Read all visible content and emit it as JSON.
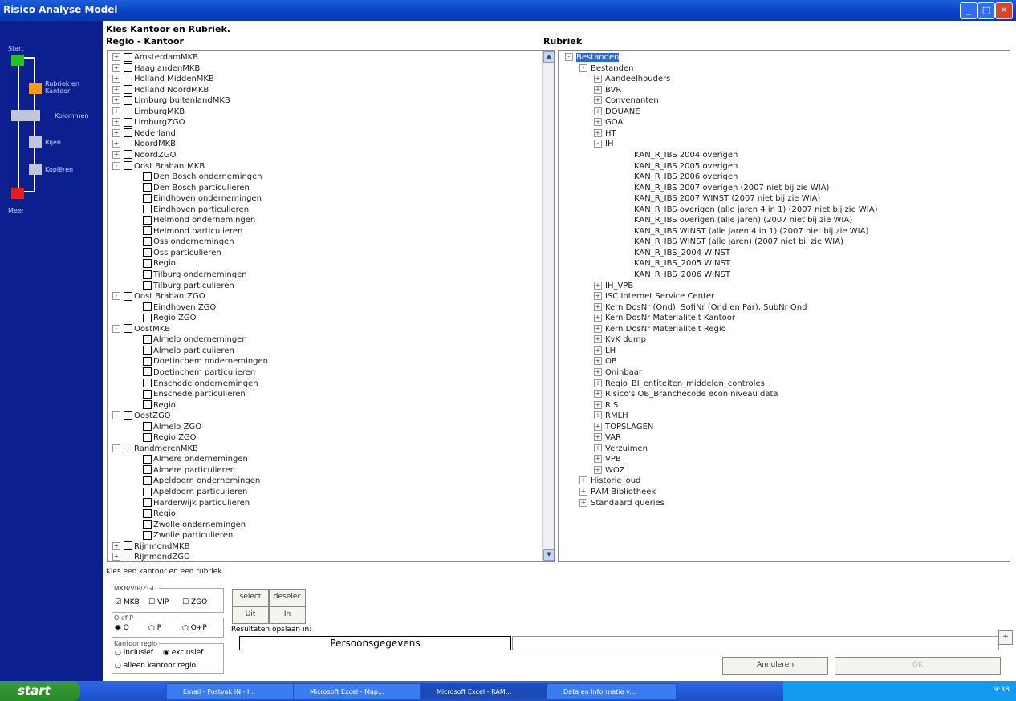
{
  "window": {
    "title": "Risico Analyse Model"
  },
  "wizard": {
    "steps": [
      "Start",
      "Rubriek en Kantoor",
      "Kolommen",
      "Rijen",
      "Kopiëren",
      "Meer"
    ]
  },
  "main": {
    "heading": "Kies Kantoor en Rubriek.",
    "left_header": "Regio - Kantoor",
    "right_header": "Rubriek"
  },
  "left_tree": [
    {
      "l": 0,
      "e": "+",
      "c": true,
      "t": "AmsterdamMKB"
    },
    {
      "l": 0,
      "e": "+",
      "c": true,
      "t": "HaaglandenMKB"
    },
    {
      "l": 0,
      "e": "+",
      "c": true,
      "t": "Holland MiddenMKB"
    },
    {
      "l": 0,
      "e": "+",
      "c": true,
      "t": "Holland NoordMKB"
    },
    {
      "l": 0,
      "e": "+",
      "c": true,
      "t": "Limburg buitenlandMKB"
    },
    {
      "l": 0,
      "e": "+",
      "c": true,
      "t": "LimburgMKB"
    },
    {
      "l": 0,
      "e": "+",
      "c": true,
      "t": "LimburgZGO"
    },
    {
      "l": 0,
      "e": "+",
      "c": true,
      "t": "Nederland"
    },
    {
      "l": 0,
      "e": "+",
      "c": true,
      "t": "NoordMKB"
    },
    {
      "l": 0,
      "e": "+",
      "c": true,
      "t": "NoordZGO"
    },
    {
      "l": 0,
      "e": "-",
      "c": true,
      "t": "Oost BrabantMKB"
    },
    {
      "l": 1,
      "e": "",
      "c": true,
      "t": "Den Bosch ondernemingen"
    },
    {
      "l": 1,
      "e": "",
      "c": true,
      "t": "Den Bosch particulieren"
    },
    {
      "l": 1,
      "e": "",
      "c": true,
      "t": "Eindhoven ondernemingen"
    },
    {
      "l": 1,
      "e": "",
      "c": true,
      "t": "Eindhoven particulieren"
    },
    {
      "l": 1,
      "e": "",
      "c": true,
      "t": "Helmond ondernemingen"
    },
    {
      "l": 1,
      "e": "",
      "c": true,
      "t": "Helmond particulieren"
    },
    {
      "l": 1,
      "e": "",
      "c": true,
      "t": "Oss ondernemingen"
    },
    {
      "l": 1,
      "e": "",
      "c": true,
      "t": "Oss particulieren"
    },
    {
      "l": 1,
      "e": "",
      "c": true,
      "t": "Regio"
    },
    {
      "l": 1,
      "e": "",
      "c": true,
      "t": "Tilburg ondernemingen"
    },
    {
      "l": 1,
      "e": "",
      "c": true,
      "t": "Tilburg particulieren"
    },
    {
      "l": 0,
      "e": "-",
      "c": true,
      "t": "Oost BrabantZGO"
    },
    {
      "l": 1,
      "e": "",
      "c": true,
      "t": "Eindhoven ZGO"
    },
    {
      "l": 1,
      "e": "",
      "c": true,
      "t": "Regio ZGO"
    },
    {
      "l": 0,
      "e": "-",
      "c": true,
      "t": "OostMKB"
    },
    {
      "l": 1,
      "e": "",
      "c": true,
      "t": "Almelo ondernemingen"
    },
    {
      "l": 1,
      "e": "",
      "c": true,
      "t": "Almelo particulieren"
    },
    {
      "l": 1,
      "e": "",
      "c": true,
      "t": "Doetinchem ondernemingen"
    },
    {
      "l": 1,
      "e": "",
      "c": true,
      "t": "Doetinchem particulieren"
    },
    {
      "l": 1,
      "e": "",
      "c": true,
      "t": "Enschede ondernemingen"
    },
    {
      "l": 1,
      "e": "",
      "c": true,
      "t": "Enschede particulieren"
    },
    {
      "l": 1,
      "e": "",
      "c": true,
      "t": "Regio"
    },
    {
      "l": 0,
      "e": "-",
      "c": true,
      "t": "OostZGO"
    },
    {
      "l": 1,
      "e": "",
      "c": true,
      "t": "Almelo ZGO"
    },
    {
      "l": 1,
      "e": "",
      "c": true,
      "t": "Regio ZGO"
    },
    {
      "l": 0,
      "e": "-",
      "c": true,
      "t": "RandmerenMKB"
    },
    {
      "l": 1,
      "e": "",
      "c": true,
      "t": "Almere ondernemingen"
    },
    {
      "l": 1,
      "e": "",
      "c": true,
      "t": "Almere particulieren"
    },
    {
      "l": 1,
      "e": "",
      "c": true,
      "t": "Apeldoorn ondernemingen"
    },
    {
      "l": 1,
      "e": "",
      "c": true,
      "t": "Apeldoorn particulieren"
    },
    {
      "l": 1,
      "e": "",
      "c": true,
      "t": "Harderwijk particulieren"
    },
    {
      "l": 1,
      "e": "",
      "c": true,
      "t": "Regio"
    },
    {
      "l": 1,
      "e": "",
      "c": true,
      "t": "Zwolle ondernemingen"
    },
    {
      "l": 1,
      "e": "",
      "c": true,
      "t": "Zwolle particulieren"
    },
    {
      "l": 0,
      "e": "+",
      "c": true,
      "t": "RijnmondMKB"
    },
    {
      "l": 0,
      "e": "+",
      "c": true,
      "t": "RijnmondZGO"
    }
  ],
  "right_tree": [
    {
      "l": 0,
      "e": "-",
      "t": "Bestanden",
      "sel": true
    },
    {
      "l": 1,
      "e": "-",
      "t": "Bestanden"
    },
    {
      "l": 2,
      "e": "+",
      "t": "Aandeelhouders"
    },
    {
      "l": 2,
      "e": "+",
      "t": "BVR"
    },
    {
      "l": 2,
      "e": "+",
      "t": "Convenanten"
    },
    {
      "l": 2,
      "e": "+",
      "t": "DOUANE"
    },
    {
      "l": 2,
      "e": "+",
      "t": "GOA"
    },
    {
      "l": 2,
      "e": "+",
      "t": "HT"
    },
    {
      "l": 2,
      "e": "-",
      "t": "IH"
    },
    {
      "l": 4,
      "e": "",
      "t": "KAN_R_IBS 2004 overigen"
    },
    {
      "l": 4,
      "e": "",
      "t": "KAN_R_IBS 2005 overigen"
    },
    {
      "l": 4,
      "e": "",
      "t": "KAN_R_IBS 2006 overigen"
    },
    {
      "l": 4,
      "e": "",
      "t": "KAN_R_IBS 2007 overigen (2007 niet bij zie WIA)"
    },
    {
      "l": 4,
      "e": "",
      "t": "KAN_R_IBS 2007 WINST (2007 niet bij zie WIA)"
    },
    {
      "l": 4,
      "e": "",
      "t": "KAN_R_IBS overigen (alle jaren 4 in 1) (2007 niet bij zie WIA)"
    },
    {
      "l": 4,
      "e": "",
      "t": "KAN_R_IBS overigen (alle jaren) (2007 niet bij zie WIA)"
    },
    {
      "l": 4,
      "e": "",
      "t": "KAN_R_IBS WINST  (alle jaren 4 in 1) (2007 niet bij zie WIA)"
    },
    {
      "l": 4,
      "e": "",
      "t": "KAN_R_IBS WINST  (alle jaren) (2007 niet bij zie WIA)"
    },
    {
      "l": 4,
      "e": "",
      "t": "KAN_R_IBS_2004 WINST"
    },
    {
      "l": 4,
      "e": "",
      "t": "KAN_R_IBS_2005 WINST"
    },
    {
      "l": 4,
      "e": "",
      "t": "KAN_R_IBS_2006 WINST"
    },
    {
      "l": 2,
      "e": "+",
      "t": "IH_VPB"
    },
    {
      "l": 2,
      "e": "+",
      "t": "ISC Internet Service Center"
    },
    {
      "l": 2,
      "e": "+",
      "t": "Kern DosNr (Ond), SofiNr (Ond en Par), SubNr Ond"
    },
    {
      "l": 2,
      "e": "+",
      "t": "Kern DosNr Materialiteit Kantoor"
    },
    {
      "l": 2,
      "e": "+",
      "t": "Kern DosNr Materialiteit Regio"
    },
    {
      "l": 2,
      "e": "+",
      "t": "KvK dump"
    },
    {
      "l": 2,
      "e": "+",
      "t": "LH"
    },
    {
      "l": 2,
      "e": "+",
      "t": "OB"
    },
    {
      "l": 2,
      "e": "+",
      "t": "Oninbaar"
    },
    {
      "l": 2,
      "e": "+",
      "t": "Regio_BI_entiteiten_middelen_controles"
    },
    {
      "l": 2,
      "e": "+",
      "t": "Risico's OB_Branchecode econ niveau data"
    },
    {
      "l": 2,
      "e": "+",
      "t": "RIS"
    },
    {
      "l": 2,
      "e": "+",
      "t": "RMLH"
    },
    {
      "l": 2,
      "e": "+",
      "t": "TOPSLAGEN"
    },
    {
      "l": 2,
      "e": "+",
      "t": "VAR"
    },
    {
      "l": 2,
      "e": "+",
      "t": "Verzuimen"
    },
    {
      "l": 2,
      "e": "+",
      "t": "VPB"
    },
    {
      "l": 2,
      "e": "+",
      "t": "WOZ"
    },
    {
      "l": 1,
      "e": "+",
      "t": "Historie_oud"
    },
    {
      "l": 1,
      "e": "+",
      "t": "RAM Bibliotheek"
    },
    {
      "l": 1,
      "e": "+",
      "t": "Standaard queries"
    }
  ],
  "status": "Kies een kantoor en een rubriek",
  "filters": {
    "group1_legend": "MKB/VIP/ZGO",
    "mkb": "MKB",
    "vip": "VIP",
    "zgo": "ZGO",
    "group2_legend": "O of P",
    "o": "O",
    "p": "P",
    "op": "O+P",
    "group3_legend": "Kantoor regio",
    "inclusief": "inclusief",
    "exclusief": "exclusief",
    "alleen": "alleen kantoor regio"
  },
  "buttons": {
    "select": "select",
    "deselect": "deselec",
    "uit": "Uit",
    "in": "In",
    "plus": "+",
    "annuleren": "Annuleren",
    "ok": "OK"
  },
  "save": {
    "label": "Resultaten opslaan in:",
    "value": "Persoonsgegevens"
  },
  "taskbar": {
    "start": "start",
    "items": [
      "Email - Postvak IN - I...",
      "Microsoft Excel - Map...",
      "Microsoft Excel - RAM...",
      "Data en Informatie v..."
    ],
    "clock": "9:38"
  }
}
